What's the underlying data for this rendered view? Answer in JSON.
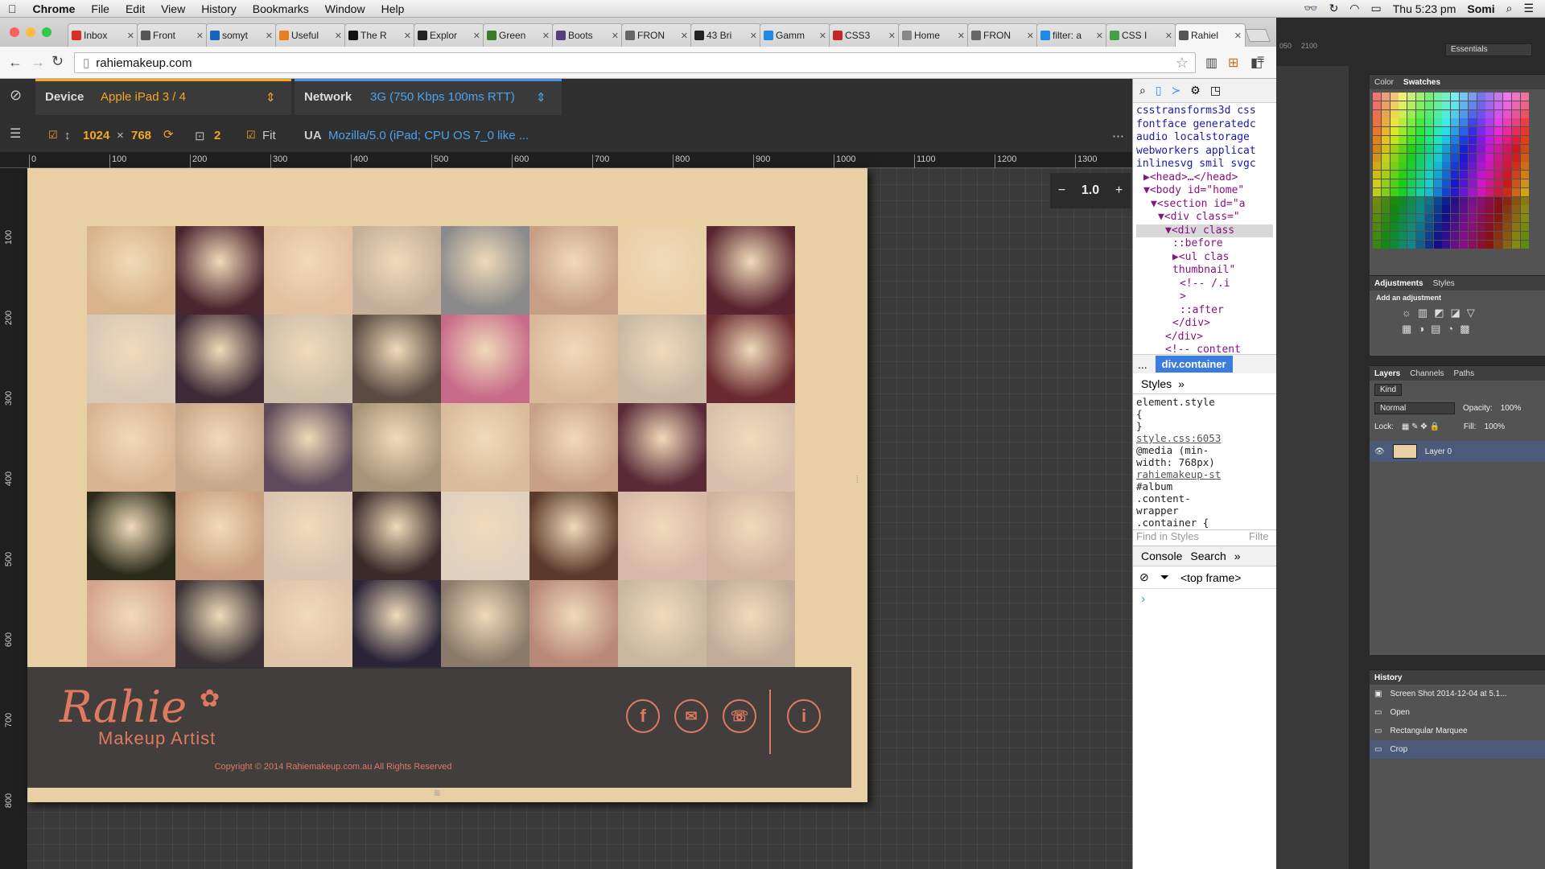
{
  "menubar": {
    "app": "Chrome",
    "items": [
      "File",
      "Edit",
      "View",
      "History",
      "Bookmarks",
      "Window",
      "Help"
    ],
    "clock": "Thu 5:23 pm",
    "user": "Somi"
  },
  "tabs": [
    {
      "label": "Inbox",
      "color": "#d93025"
    },
    {
      "label": "Front",
      "color": "#555"
    },
    {
      "label": "somyt",
      "color": "#1565c0"
    },
    {
      "label": "Useful",
      "color": "#e67e22"
    },
    {
      "label": "The R",
      "color": "#111"
    },
    {
      "label": "Explor",
      "color": "#222"
    },
    {
      "label": "Green",
      "color": "#3a7a2a"
    },
    {
      "label": "Boots",
      "color": "#563d7c"
    },
    {
      "label": "FRON",
      "color": "#666"
    },
    {
      "label": "43 Bri",
      "color": "#222"
    },
    {
      "label": "Gamm",
      "color": "#1e88e5"
    },
    {
      "label": "CSS3",
      "color": "#c62828"
    },
    {
      "label": "Home",
      "color": "#888"
    },
    {
      "label": "FRON",
      "color": "#666"
    },
    {
      "label": "filter: a",
      "color": "#1e88e5"
    },
    {
      "label": "CSS I",
      "color": "#43a047"
    },
    {
      "label": "Rahiel",
      "color": "#555"
    }
  ],
  "url": "rahiemakeup.com",
  "devbar": {
    "device_label": "Device",
    "device_value": "Apple iPad 3 / 4",
    "network_label": "Network",
    "network_value": "3G (750 Kbps 100ms RTT)",
    "width": "1024",
    "times": "×",
    "height": "768",
    "dpr": "2",
    "fit_label": "Fit",
    "ua_label": "UA",
    "ua_value": "Mozilla/5.0 (iPad; CPU OS 7_0 like ..."
  },
  "ruler_top": [
    "0",
    "100",
    "200",
    "300",
    "400",
    "500",
    "600",
    "700",
    "800",
    "900",
    "1000",
    "1100",
    "1200",
    "1300"
  ],
  "ruler_left": [
    "100",
    "200",
    "300",
    "400",
    "500",
    "600",
    "700",
    "800"
  ],
  "zoom_value": "1.0",
  "site": {
    "logo_name": "Rahie",
    "logo_tag": "Makeup Artist",
    "copyright": "Copyright © 2014 Rahiemakeup.com.au All Rights Reserved",
    "social_icons": [
      "facebook-icon",
      "mail-icon",
      "phone-icon",
      "info-icon"
    ]
  },
  "devtools": {
    "elements_lines": [
      "csstransforms3d css",
      "fontface generatedc",
      "audio localstorage",
      "webworkers applicat",
      "inlinesvg smil svgc",
      "▶<head>…</head>",
      "▼<body id=\"home\"",
      "▼<section id=\"a",
      "▼<div class=\"",
      "▼<div class",
      "::before",
      "▶<ul clas",
      "thumbnail\"",
      "<!-- /.i",
      ">",
      "::after",
      "</div>",
      "</div>",
      "<!-- content"
    ],
    "breadcrumb_more": "...",
    "breadcrumb": "div.container",
    "styles_tab": "Styles",
    "styles_more": "»",
    "style_lines": [
      "element.style",
      "{",
      "}",
      "style.css:6053",
      "@media (min-",
      "width: 768px)",
      "rahiemakeup-st",
      "#album",
      ".content-",
      "wrapper",
      ".container {"
    ],
    "find_placeholder": "Find in Styles",
    "filter_placeholder": "Filte",
    "console_tab": "Console",
    "search_tab": "Search",
    "frame": "<top frame>",
    "prompt": "›"
  },
  "photoshop": {
    "workspace": "Essentials",
    "color_tab": "Color",
    "swatches_tab": "Swatches",
    "adjust_tab": "Adjustments",
    "styles_tab": "Styles",
    "add_adjustment": "Add an adjustment",
    "layers_tab": "Layers",
    "channels_tab": "Channels",
    "paths_tab": "Paths",
    "kind": "Kind",
    "blend": "Normal",
    "opacity_label": "Opacity:",
    "opacity": "100%",
    "lock_label": "Lock:",
    "fill_label": "Fill:",
    "fill": "100%",
    "layer_name": "Layer 0",
    "history_tab": "History",
    "history_items": [
      "Screen Shot 2014-12-04 at 5.1...",
      "Open",
      "Rectangular Marquee",
      "Crop"
    ],
    "ruler_marks": [
      "050",
      "2100"
    ]
  }
}
